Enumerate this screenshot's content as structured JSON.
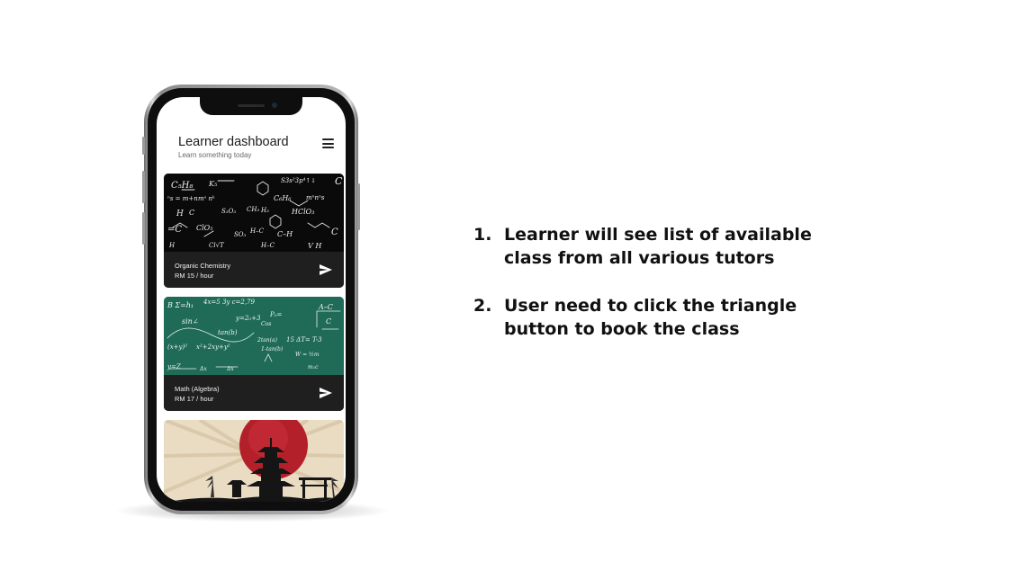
{
  "app": {
    "title": "Learner dashboard",
    "subtitle": "Learn something today"
  },
  "classes": [
    {
      "name": "Organic Chemistry",
      "price": "RM 15 / hour"
    },
    {
      "name": "Math (Algebra)",
      "price": "RM 17 / hour"
    }
  ],
  "instructions": [
    {
      "number": "1.",
      "line1": "Learner will see list of available",
      "line2": "class from all various tutors"
    },
    {
      "number": "2.",
      "line1": "User need to click the triangle",
      "line2": "button to book the class"
    }
  ],
  "icons": {
    "menu": "hamburger-menu-icon",
    "send": "send-triangle-icon"
  },
  "colors": {
    "card_background": "#1f1f1f",
    "chalkboard_green": "#1f6b57",
    "chalkboard_black": "#0a0a0a",
    "japan_sun_red": "#b3202a",
    "japan_background": "#e9dcc3"
  }
}
